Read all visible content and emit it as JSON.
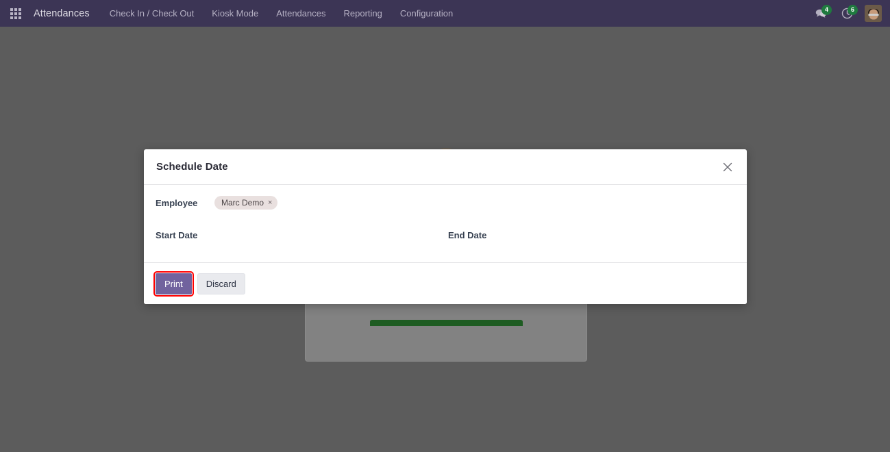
{
  "navbar": {
    "apps_icon": "apps-grid-icon",
    "brand": "Attendances",
    "menu": [
      {
        "label": "Check In / Check Out"
      },
      {
        "label": "Kiosk Mode"
      },
      {
        "label": "Attendances"
      },
      {
        "label": "Reporting"
      },
      {
        "label": "Configuration"
      }
    ],
    "messages_icon": "chat-bubble-icon",
    "messages_count": "4",
    "activities_icon": "clock-icon",
    "activities_count": "6",
    "avatar_icon": "user-avatar"
  },
  "dialog": {
    "title": "Schedule Date",
    "close_icon": "close-icon",
    "fields": {
      "employee_label": "Employee",
      "employee_tag": "Marc Demo",
      "employee_tag_remove_icon": "×",
      "start_date_label": "Start Date",
      "start_date_value": "",
      "start_date_placeholder": "",
      "end_date_label": "End Date",
      "end_date_value": "",
      "end_date_placeholder": ""
    },
    "footer": {
      "print_label": "Print",
      "discard_label": "Discard"
    }
  },
  "colors": {
    "navbar_bg": "#3c3555",
    "overlay": "#5c5c5c",
    "primary": "#71639e",
    "badge_green": "#1f7a3f",
    "tag_bg": "#e9e0df",
    "focus_red": "#ff0000"
  }
}
